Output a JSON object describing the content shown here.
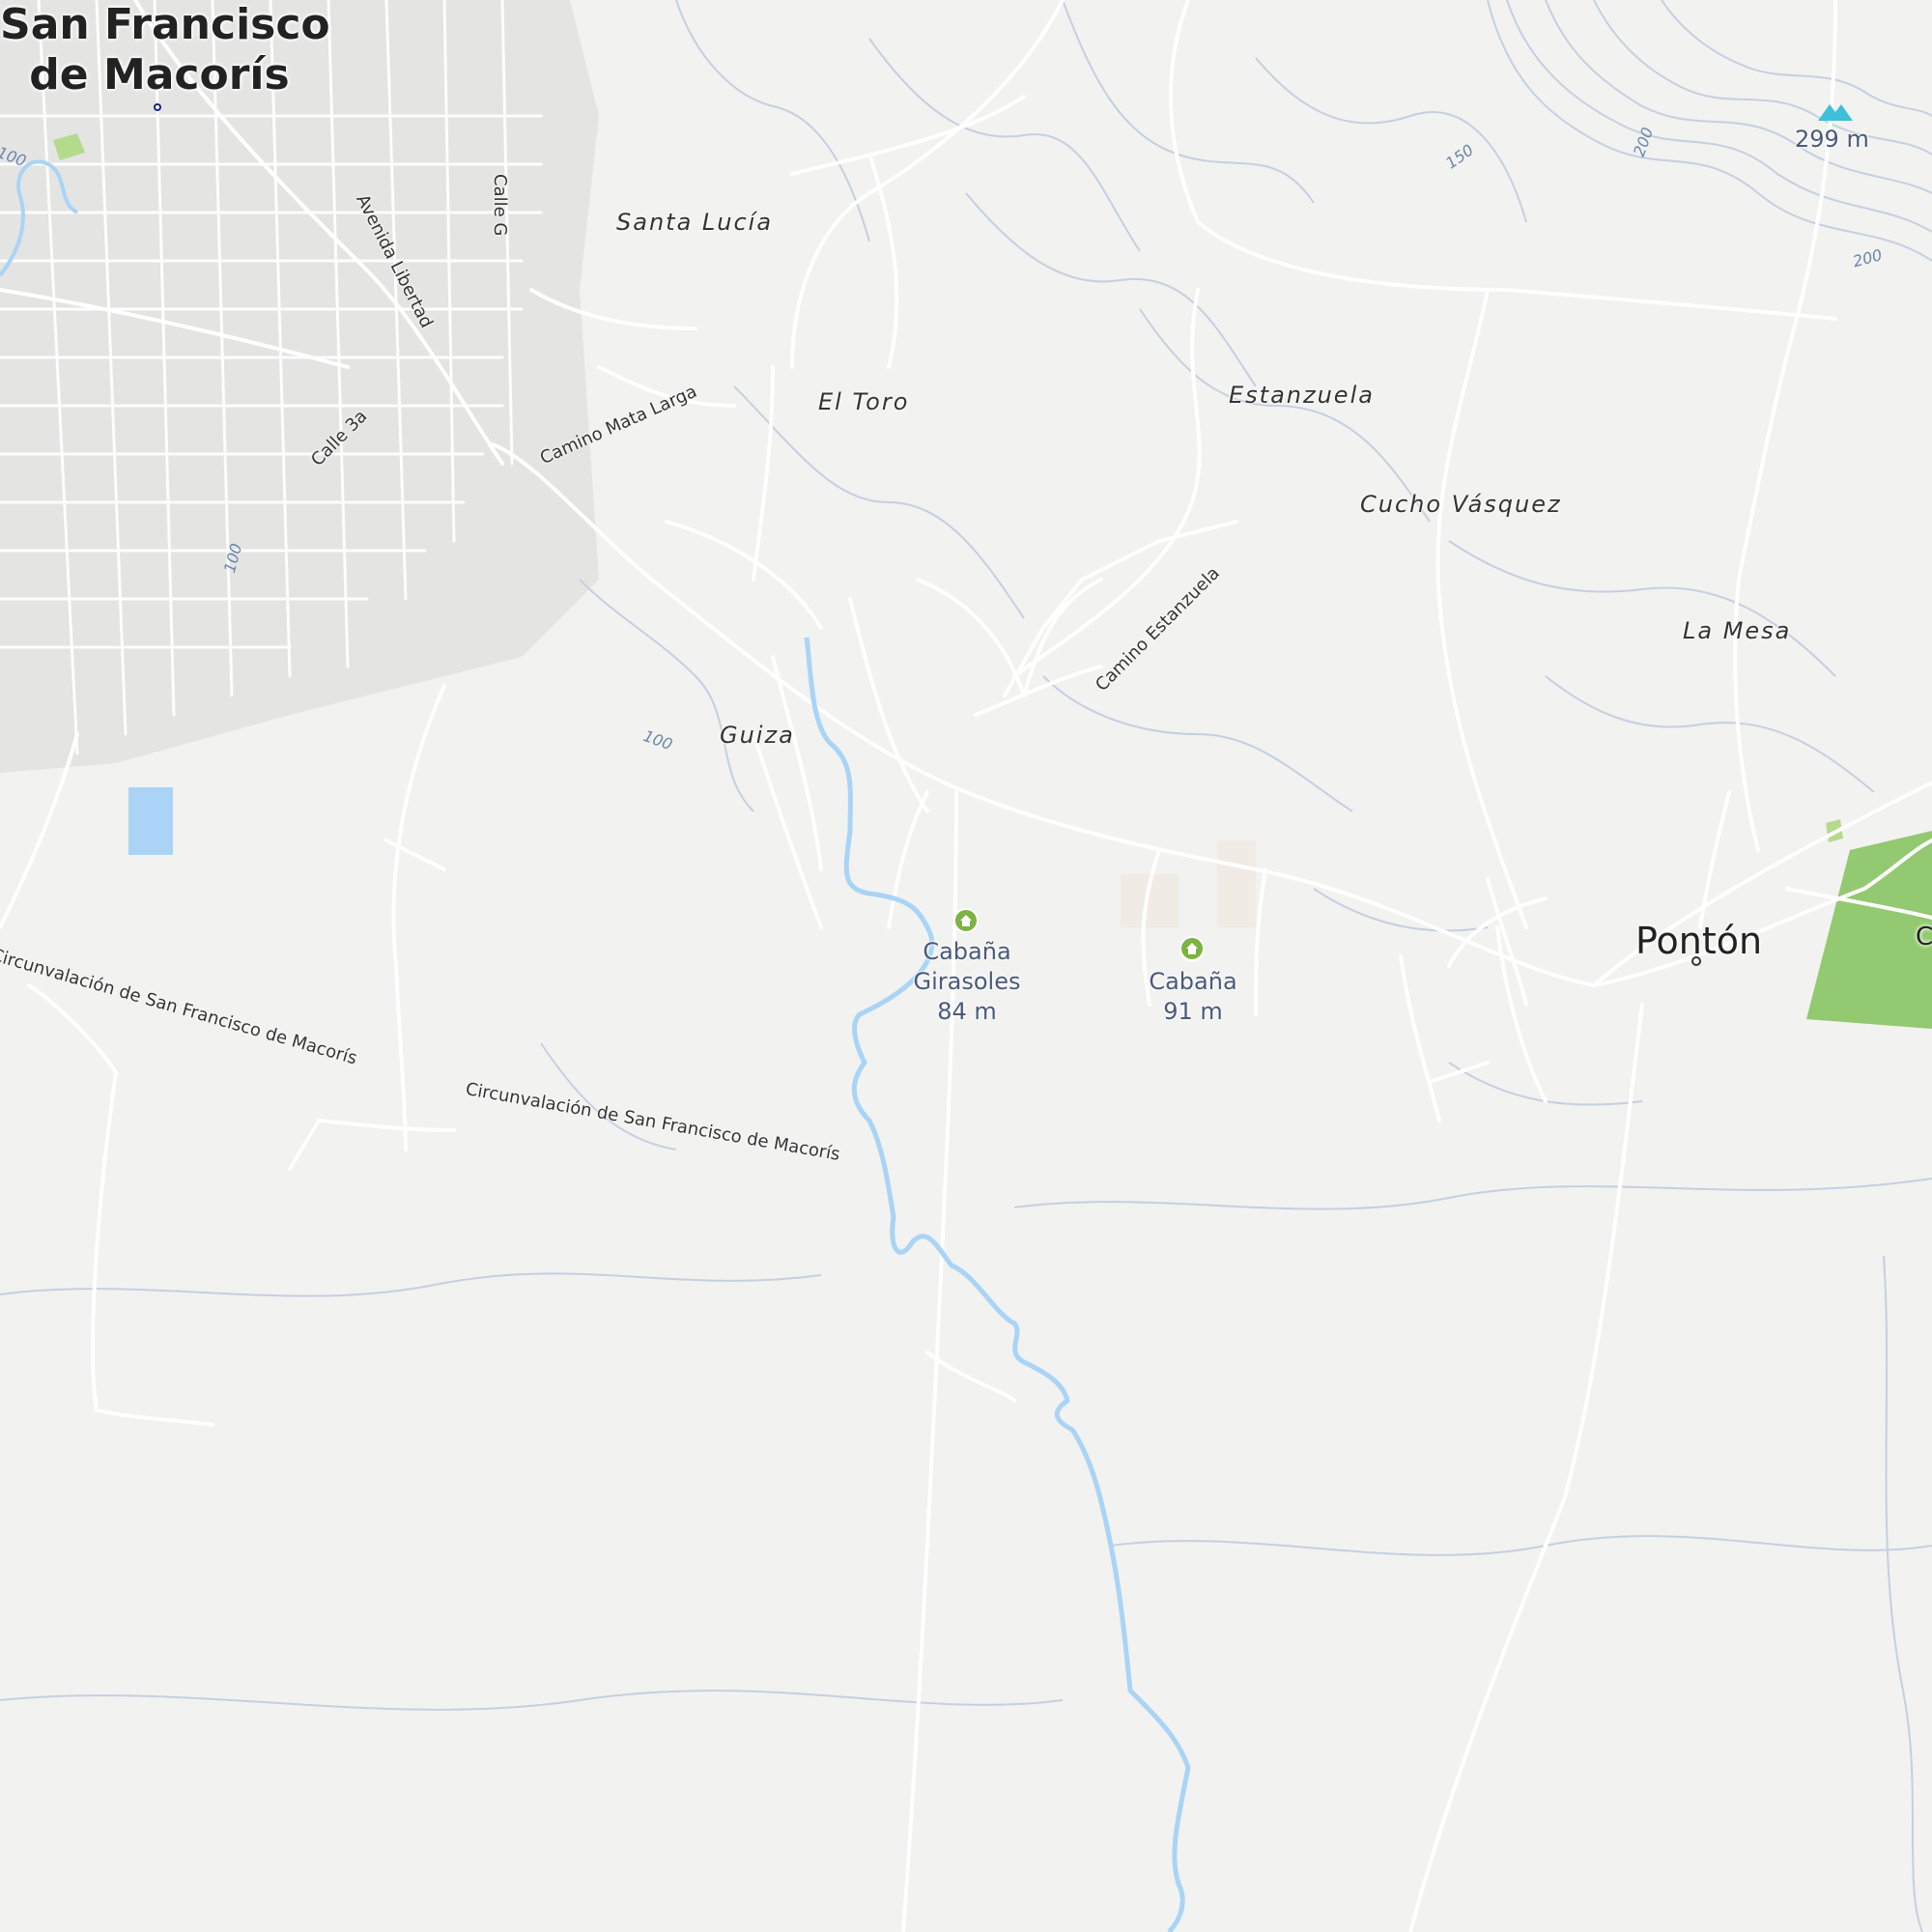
{
  "map": {
    "city": {
      "line1": "San Francisco",
      "line2": "de Macorís"
    },
    "town": {
      "name": "Pontón"
    },
    "town_cut": {
      "name": "C"
    },
    "villages": {
      "santa_lucia": "Santa Lucía",
      "el_toro": "El Toro",
      "estanzuela": "Estanzuela",
      "cucho_vasquez": "Cucho Vásquez",
      "la_mesa": "La Mesa",
      "guiza": "Guiza"
    },
    "roads": {
      "avenida_libertad": "Avenida Libertad",
      "calle_g": "Calle G",
      "calle_3a": "Calle 3a",
      "camino_mata_larga": "Camino Mata Larga",
      "camino_estanzuela": "Camino Estanzuela",
      "circunvalacion_1": "Circunvalación de San Francisco de Macorís",
      "circunvalacion_2": "Circunvalación de San Francisco de Macorís"
    },
    "pois": {
      "cabana_girasoles": {
        "name_line1": "Cabaña",
        "name_line2": "Girasoles",
        "elevation": "84 m",
        "icon": "lodging-icon"
      },
      "cabana": {
        "name": "Cabaña",
        "elevation": "91 m",
        "icon": "lodging-icon"
      }
    },
    "peak": {
      "elevation": "299 m",
      "icon": "mountain-peak-icon"
    },
    "contours": {
      "c100a": "100",
      "c100b": "100",
      "c100c": "100",
      "c150": "150",
      "c200a": "200",
      "c200b": "200"
    },
    "colors": {
      "background": "#f2f2f1",
      "urban": "#e4e4e3",
      "road": "#ffffff",
      "water": "#a9d4f5",
      "contour": "#c7d0de",
      "park": "#8fc66e",
      "poi": "#7cb342",
      "peak": "#3fbfd8"
    }
  }
}
